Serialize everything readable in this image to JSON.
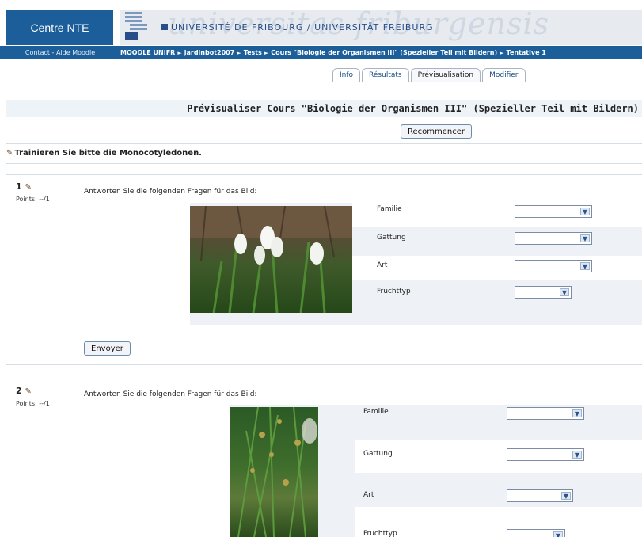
{
  "header": {
    "brand": "Centre NTE",
    "university": "UNIVERSITÉ DE FRIBOURG / UNIVERSITÄT FREIBURG",
    "watermark": "universitas friburgensis"
  },
  "navbar": {
    "left_link": "Contact - Aide Moodle",
    "breadcrumbs": [
      "MOODLE UNIFR",
      "jardinbot2007",
      "Tests",
      "Cours \"Biologie der Organismen III\" (Spezieller Teil mit Bildern)",
      "Tentative 1"
    ],
    "separator": "►"
  },
  "tabs": [
    {
      "label": "Info",
      "active": false
    },
    {
      "label": "Résultats",
      "active": false
    },
    {
      "label": "Prévisualisation",
      "active": true
    },
    {
      "label": "Modifier",
      "active": false
    }
  ],
  "page_title": "Prévisualiser Cours \"Biologie der Organismen III\" (Spezieller Teil mit Bildern)",
  "restart_button": "Recommencer",
  "intro_text": "Trainieren Sie bitte die Monocotyledonen.",
  "questions": [
    {
      "number": "1",
      "points": "Points: --/1",
      "prompt": "Antworten Sie die folgenden Fragen für das Bild:",
      "fields": [
        {
          "label": "Familie",
          "value": ""
        },
        {
          "label": "Gattung",
          "value": ""
        },
        {
          "label": "Art",
          "value": ""
        },
        {
          "label": "Fruchttyp",
          "value": ""
        }
      ],
      "submit": "Envoyer"
    },
    {
      "number": "2",
      "points": "Points: --/1",
      "prompt": "Antworten Sie die folgenden Fragen für das Bild:",
      "fields": [
        {
          "label": "Familie",
          "value": ""
        },
        {
          "label": "Gattung",
          "value": ""
        },
        {
          "label": "Art",
          "value": ""
        },
        {
          "label": "Fruchttyp",
          "value": ""
        }
      ]
    }
  ],
  "icons": {
    "edit": "pencil-icon",
    "select_arrow": "chevron-down-icon"
  },
  "colors": {
    "brand_blue": "#1b5e99",
    "link_blue": "#1b4a86"
  }
}
